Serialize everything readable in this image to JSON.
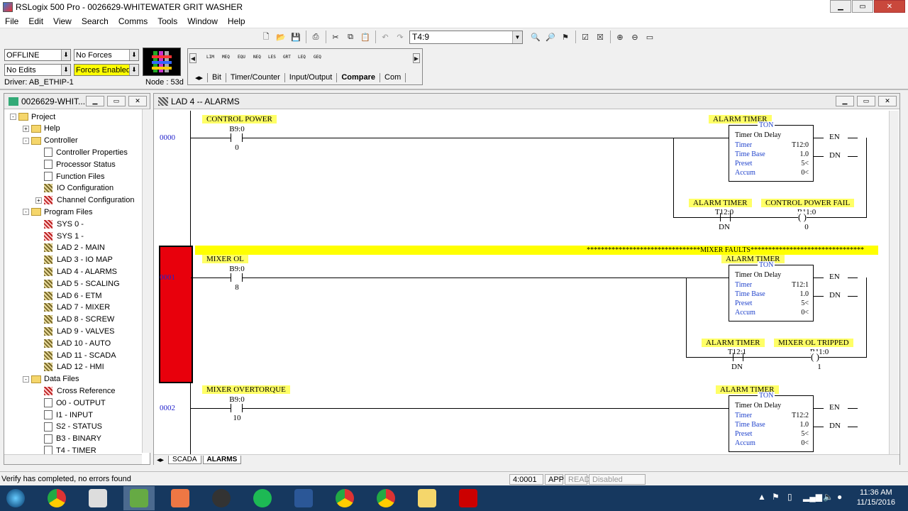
{
  "window": {
    "title": "RSLogix 500 Pro - 0026629-WHITEWATER GRIT WASHER",
    "min": "▁",
    "max": "▭",
    "close": "✕"
  },
  "menu": [
    "File",
    "Edit",
    "View",
    "Search",
    "Comms",
    "Tools",
    "Window",
    "Help"
  ],
  "toolbar": {
    "address": "T4:9"
  },
  "status_panel": {
    "mode": "OFFLINE",
    "forces": "No Forces",
    "edits": "No Edits",
    "forces_enabled": "Forces Enabled",
    "driver": "Driver: AB_ETHIP-1",
    "node": "Node : 53d"
  },
  "instructions": [
    "LIM",
    "MEQ",
    "EQU",
    "NEQ",
    "LES",
    "GRT",
    "LEQ",
    "GEQ"
  ],
  "instruction_tabs": [
    "Bit",
    "Timer/Counter",
    "Input/Output",
    "Compare",
    "Com"
  ],
  "project": {
    "title": "0026629-WHIT...",
    "tree": [
      "Project",
      "Help",
      "Controller",
      "Controller Properties",
      "Processor Status",
      "Function Files",
      "IO Configuration",
      "Channel Configuration",
      "Program Files",
      "SYS 0 -",
      "SYS 1 -",
      "LAD 2 - MAIN",
      "LAD 3 - IO MAP",
      "LAD 4 - ALARMS",
      "LAD 5 - SCALING",
      "LAD 6 - ETM",
      "LAD 7 - MIXER",
      "LAD 8 - SCREW",
      "LAD 9 - VALVES",
      "LAD 10 - AUTO",
      "LAD 11 - SCADA",
      "LAD 12 - HMI",
      "Data Files",
      "Cross Reference",
      "O0 - OUTPUT",
      "I1 - INPUT",
      "S2 - STATUS",
      "B3 - BINARY",
      "T4 - TIMER"
    ],
    "expander_plus": "+",
    "expander_minus": "-"
  },
  "ladder": {
    "title": "LAD 4 -- ALARMS",
    "fault_comment": "********************************MIXER FAULTS********************************",
    "rungs": [
      {
        "num": "0000",
        "contact_label": "CONTROL POWER",
        "contact_addr": "B9:0",
        "contact_bit": "0",
        "timer_label": "ALARM TIMER",
        "ton": "TON",
        "ton_name": "Timer On Delay",
        "timer_key": "Timer",
        "timer": "T12:0",
        "tb_key": "Time Base",
        "timebase": "1.0",
        "preset_key": "Preset",
        "preset": "5<",
        "accum_key": "Accum",
        "accum": "0<",
        "en": "EN",
        "dn": "DN",
        "b_label1": "ALARM TIMER",
        "b_addr1": "T12:0",
        "b_bit1": "DN",
        "b_label2": "CONTROL POWER FAIL",
        "b_addr2": "B11:0",
        "b_bit2": "0"
      },
      {
        "num": "0001",
        "contact_label": "MIXER OL",
        "contact_addr": "B9:0",
        "contact_bit": "8",
        "timer_label": "ALARM TIMER",
        "ton": "TON",
        "ton_name": "Timer On Delay",
        "timer_key": "Timer",
        "timer": "T12:1",
        "tb_key": "Time Base",
        "timebase": "1.0",
        "preset_key": "Preset",
        "preset": "5<",
        "accum_key": "Accum",
        "accum": "0<",
        "en": "EN",
        "dn": "DN",
        "b_label1": "ALARM TIMER",
        "b_addr1": "T12:1",
        "b_bit1": "DN",
        "b_label2": "MIXER OL TRIPPED",
        "b_addr2": "B11:0",
        "b_bit2": "1"
      },
      {
        "num": "0002",
        "contact_label": "MIXER OVERTORQUE",
        "contact_addr": "B9:0",
        "contact_bit": "10",
        "timer_label": "ALARM TIMER",
        "ton": "TON",
        "ton_name": "Timer On Delay",
        "timer_key": "Timer",
        "timer": "T12:2",
        "tb_key": "Time Base",
        "timebase": "1.0",
        "preset_key": "Preset",
        "preset": "5<",
        "accum_key": "Accum",
        "accum": "0<",
        "en": "EN",
        "dn": "DN"
      }
    ],
    "bottom_tabs": [
      "SCADA",
      "ALARMS"
    ]
  },
  "statusbar": {
    "message": "Verify has completed, no errors found",
    "address": "4:0001",
    "app": "APP",
    "read": "READ",
    "disabled": "Disabled"
  },
  "taskbar": {
    "time": "11:36 AM",
    "date": "11/15/2016"
  }
}
